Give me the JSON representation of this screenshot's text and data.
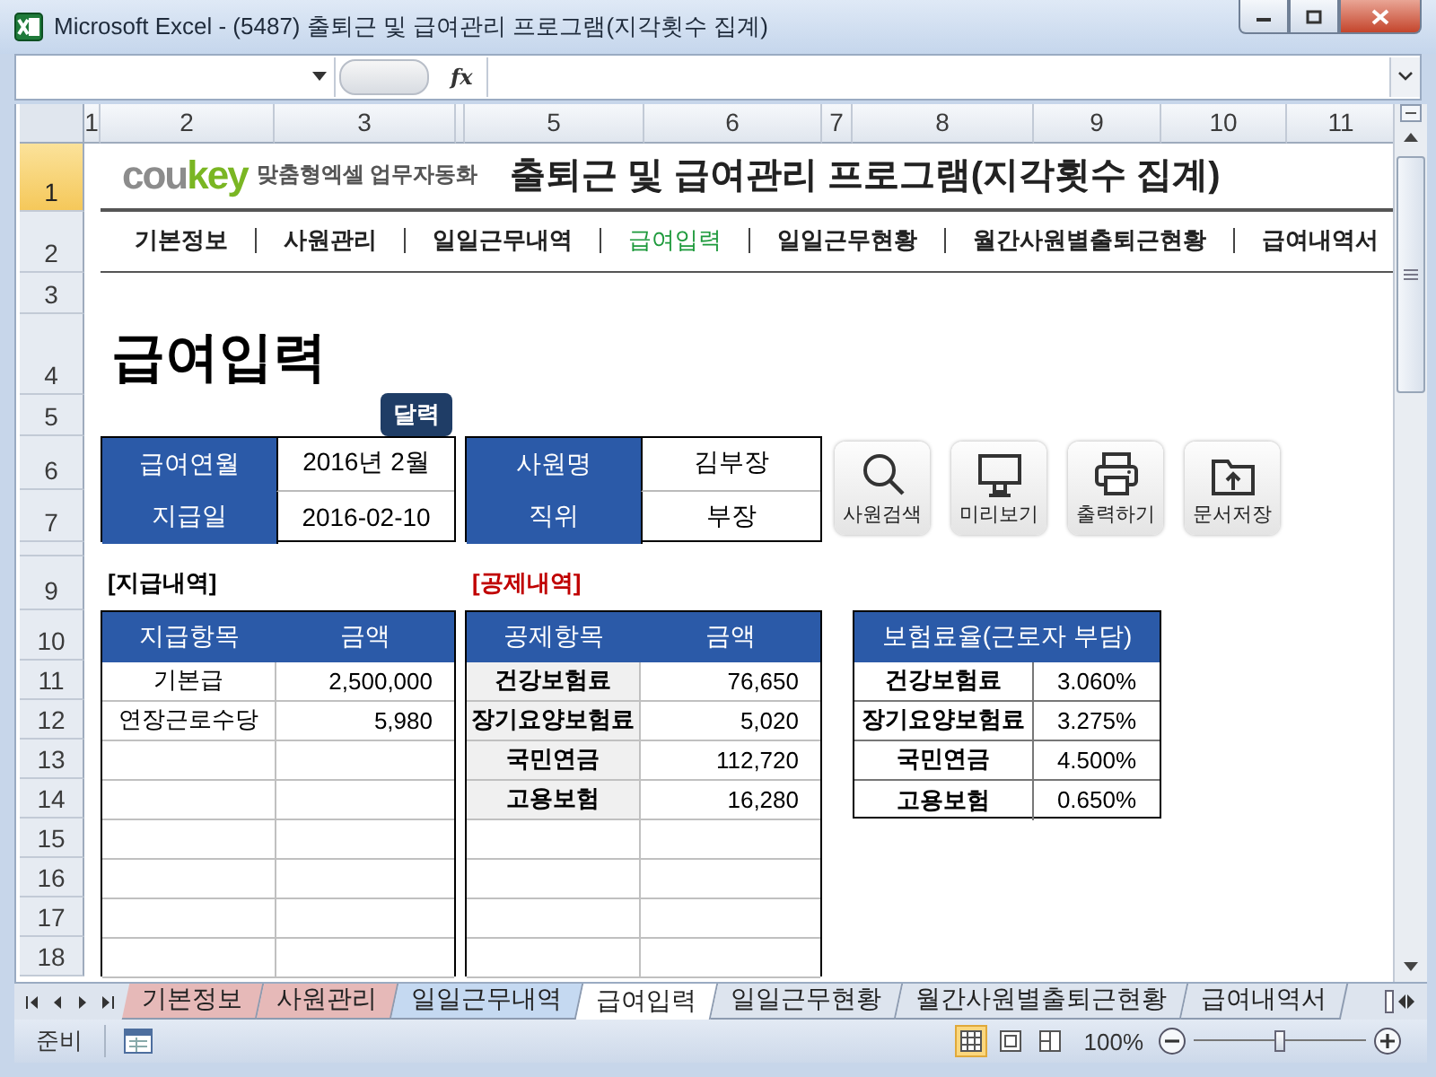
{
  "window": {
    "title": "Microsoft Excel - (5487) 출퇴근 및 급여관리 프로그램(지각횟수 집계)"
  },
  "formula_bar": {
    "fx_label": "fx"
  },
  "column_headers": [
    "1",
    "2",
    "3",
    "5",
    "6",
    "7",
    "8",
    "9",
    "10",
    "11"
  ],
  "row_headers": [
    {
      "label": "1",
      "selected": true
    },
    {
      "label": "2",
      "selected": false
    },
    {
      "label": "3",
      "selected": false
    },
    {
      "label": "4",
      "selected": false
    },
    {
      "label": "5",
      "selected": false
    },
    {
      "label": "6",
      "selected": false
    },
    {
      "label": "7",
      "selected": false
    },
    {
      "label": "9",
      "selected": false
    },
    {
      "label": "10",
      "selected": false
    },
    {
      "label": "11",
      "selected": false
    },
    {
      "label": "12",
      "selected": false
    },
    {
      "label": "13",
      "selected": false
    },
    {
      "label": "14",
      "selected": false
    },
    {
      "label": "15",
      "selected": false
    },
    {
      "label": "16",
      "selected": false
    },
    {
      "label": "17",
      "selected": false
    },
    {
      "label": "18",
      "selected": false
    }
  ],
  "logo": {
    "word_1": "cou",
    "word_2": "key",
    "tagline": "맞춤형엑셀 업무자동화"
  },
  "sheet_title": "출퇴근 및 급여관리 프로그램(지각횟수 집계)",
  "nav": [
    {
      "label": "기본정보",
      "selected": false
    },
    {
      "label": "사원관리",
      "selected": false
    },
    {
      "label": "일일근무내역",
      "selected": false
    },
    {
      "label": "급여입력",
      "selected": true
    },
    {
      "label": "일일근무현황",
      "selected": false
    },
    {
      "label": "월간사원별출퇴근현황",
      "selected": false
    },
    {
      "label": "급여내역서",
      "selected": false
    }
  ],
  "page_heading": "급여입력",
  "calendar_button": "달력",
  "info_left": [
    {
      "label": "급여연월",
      "value": "2016년 2월"
    },
    {
      "label": "지급일",
      "value": "2016-02-10"
    }
  ],
  "info_right": [
    {
      "label": "사원명",
      "value": "김부장"
    },
    {
      "label": "직위",
      "value": "부장"
    }
  ],
  "actions": [
    {
      "kind": "search",
      "label": "사원검색"
    },
    {
      "kind": "preview",
      "label": "미리보기"
    },
    {
      "kind": "print",
      "label": "출력하기"
    },
    {
      "kind": "save",
      "label": "문서저장"
    }
  ],
  "payments": {
    "title": "[지급내역]",
    "columns": [
      "지급항목",
      "금액"
    ],
    "rows": [
      [
        "기본급",
        "2,500,000"
      ],
      [
        "연장근로수당",
        "5,980"
      ]
    ]
  },
  "deductions": {
    "title": "[공제내역]",
    "columns": [
      "공제항목",
      "금액"
    ],
    "rows": [
      [
        "건강보험료",
        "76,650"
      ],
      [
        "장기요양보험료",
        "5,020"
      ],
      [
        "국민연금",
        "112,720"
      ],
      [
        "고용보험",
        "16,280"
      ]
    ]
  },
  "insurance_rates": {
    "title": "보험료율(근로자 부담)",
    "rows": [
      [
        "건강보험료",
        "3.060%"
      ],
      [
        "장기요양보험료",
        "3.275%"
      ],
      [
        "국민연금",
        "4.500%"
      ],
      [
        "고용보험",
        "0.650%"
      ]
    ]
  },
  "sheet_tabs": [
    {
      "label": "기본정보",
      "selected": false,
      "color": "#e6b9b8"
    },
    {
      "label": "사원관리",
      "selected": false,
      "color": "#e6b9b8"
    },
    {
      "label": "일일근무내역",
      "selected": false,
      "color": "#c5d9f1"
    },
    {
      "label": "급여입력",
      "selected": true
    },
    {
      "label": "일일근무현황",
      "selected": false
    },
    {
      "label": "월간사원별출퇴근현황",
      "selected": false
    },
    {
      "label": "급여내역서",
      "selected": false
    }
  ],
  "status_bar": {
    "mode": "준비",
    "zoom": "100%",
    "zoom_slider": {
      "level": 0.5
    }
  }
}
